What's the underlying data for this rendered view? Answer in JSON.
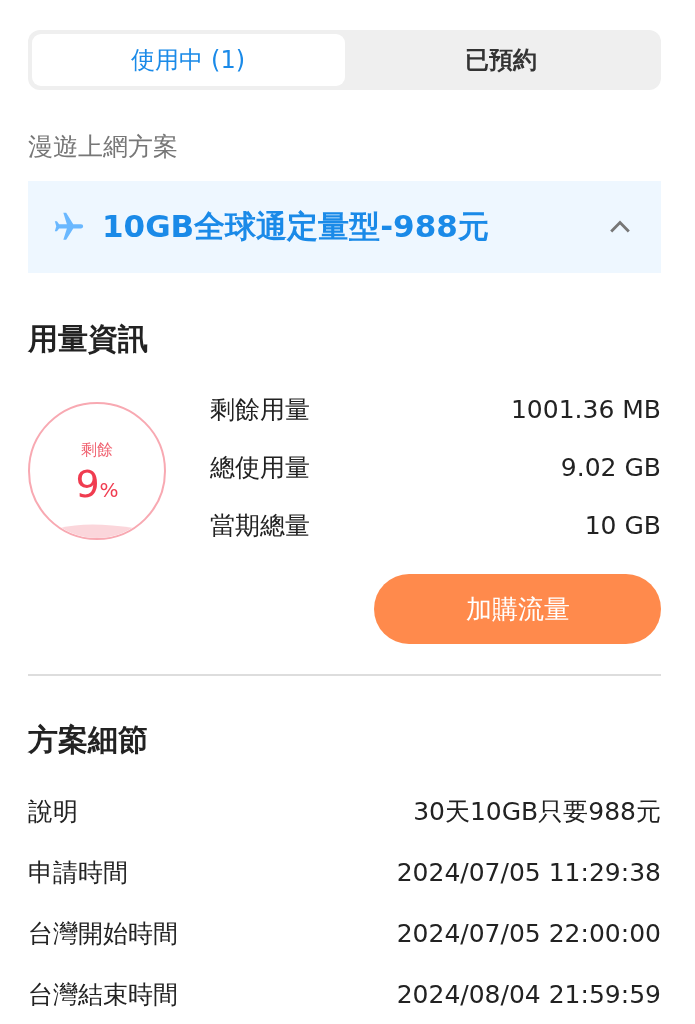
{
  "tabs": [
    {
      "label": "使用中 (1)",
      "selected": true
    },
    {
      "label": "已預約",
      "selected": false
    }
  ],
  "plan_section": {
    "label": "漫遊上網方案",
    "plan": {
      "name": "10GB全球通定量型-988元",
      "expanded": true
    }
  },
  "usage": {
    "title": "用量資訊",
    "gauge": {
      "caption": "剩餘",
      "number": "9",
      "unit": "%"
    },
    "rows": [
      {
        "label": "剩餘用量",
        "value": "1001.36 MB"
      },
      {
        "label": "總使用量",
        "value": "9.02 GB"
      },
      {
        "label": "當期總量",
        "value": "10 GB"
      }
    ],
    "button": "加購流量"
  },
  "details": {
    "title": "方案細節",
    "rows": [
      {
        "label": "說明",
        "value": "30天10GB只要988元"
      },
      {
        "label": "申請時間",
        "value": "2024/07/05 11:29:38"
      },
      {
        "label": "台灣開始時間",
        "value": "2024/07/05 22:00:00"
      },
      {
        "label": "台灣結束時間",
        "value": "2024/08/04 21:59:59"
      }
    ]
  }
}
